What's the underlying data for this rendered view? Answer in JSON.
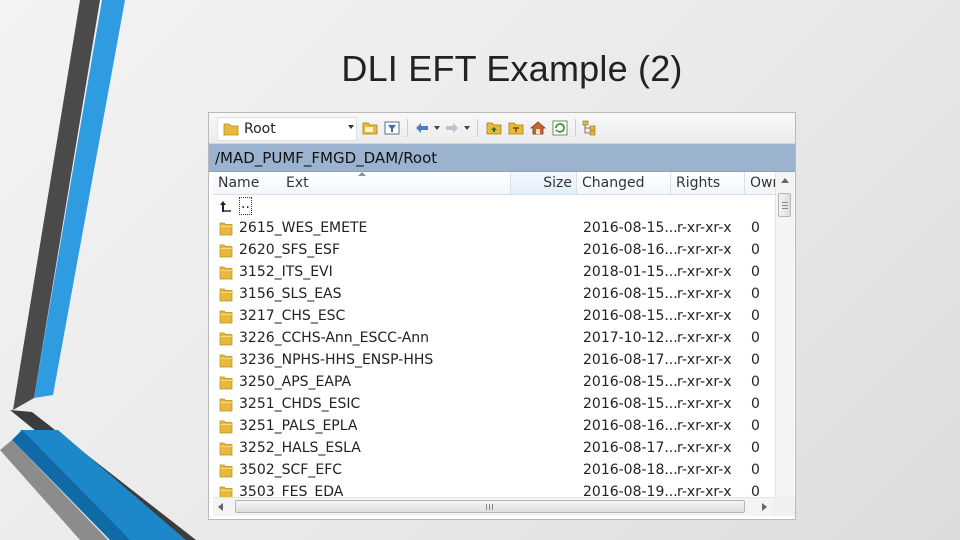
{
  "slide": {
    "title": "DLI EFT Example (2)"
  },
  "toolbar": {
    "location_combo": "Root",
    "icons": [
      "folder-open-icon",
      "filter-icon",
      "back-icon",
      "forward-icon",
      "parent-directory-icon",
      "root-directory-icon",
      "home-icon",
      "refresh-icon",
      "tree-view-icon"
    ]
  },
  "path": "/MAD_PUMF_FMGD_DAM/Root",
  "columns": {
    "name": "Name",
    "ext": "Ext",
    "size": "Size",
    "changed": "Changed",
    "rights": "Rights",
    "owner": "Owr"
  },
  "rows": [
    {
      "name": "..",
      "changed": "",
      "rights": "",
      "owner": "",
      "parent": true
    },
    {
      "name": "2615_WES_EMETE",
      "changed": "2016-08-15...",
      "rights": "r-xr-xr-x",
      "owner": "0"
    },
    {
      "name": "2620_SFS_ESF",
      "changed": "2016-08-16...",
      "rights": "r-xr-xr-x",
      "owner": "0"
    },
    {
      "name": "3152_ITS_EVI",
      "changed": "2018-01-15...",
      "rights": "r-xr-xr-x",
      "owner": "0"
    },
    {
      "name": "3156_SLS_EAS",
      "changed": "2016-08-15...",
      "rights": "r-xr-xr-x",
      "owner": "0"
    },
    {
      "name": "3217_CHS_ESC",
      "changed": "2016-08-15...",
      "rights": "r-xr-xr-x",
      "owner": "0"
    },
    {
      "name": "3226_CCHS-Ann_ESCC-Ann",
      "changed": "2017-10-12...",
      "rights": "r-xr-xr-x",
      "owner": "0"
    },
    {
      "name": "3236_NPHS-HHS_ENSP-HHS",
      "changed": "2016-08-17...",
      "rights": "r-xr-xr-x",
      "owner": "0"
    },
    {
      "name": "3250_APS_EAPA",
      "changed": "2016-08-15...",
      "rights": "r-xr-xr-x",
      "owner": "0"
    },
    {
      "name": "3251_CHDS_ESIC",
      "changed": "2016-08-15...",
      "rights": "r-xr-xr-x",
      "owner": "0"
    },
    {
      "name": "3251_PALS_EPLA",
      "changed": "2016-08-16...",
      "rights": "r-xr-xr-x",
      "owner": "0"
    },
    {
      "name": "3252_HALS_ESLA",
      "changed": "2016-08-17...",
      "rights": "r-xr-xr-x",
      "owner": "0"
    },
    {
      "name": "3502_SCF_EFC",
      "changed": "2016-08-18...",
      "rights": "r-xr-xr-x",
      "owner": "0"
    },
    {
      "name": "3503_FES_EDA",
      "changed": "2016-08-19...",
      "rights": "r-xr-xr-x",
      "owner": "0"
    }
  ],
  "colors": {
    "path_bar": "#9bb3cf",
    "folder": "#e8b93a",
    "accent_stripe": "#1c87c9",
    "dark_stripe": "#3a3a3a"
  }
}
